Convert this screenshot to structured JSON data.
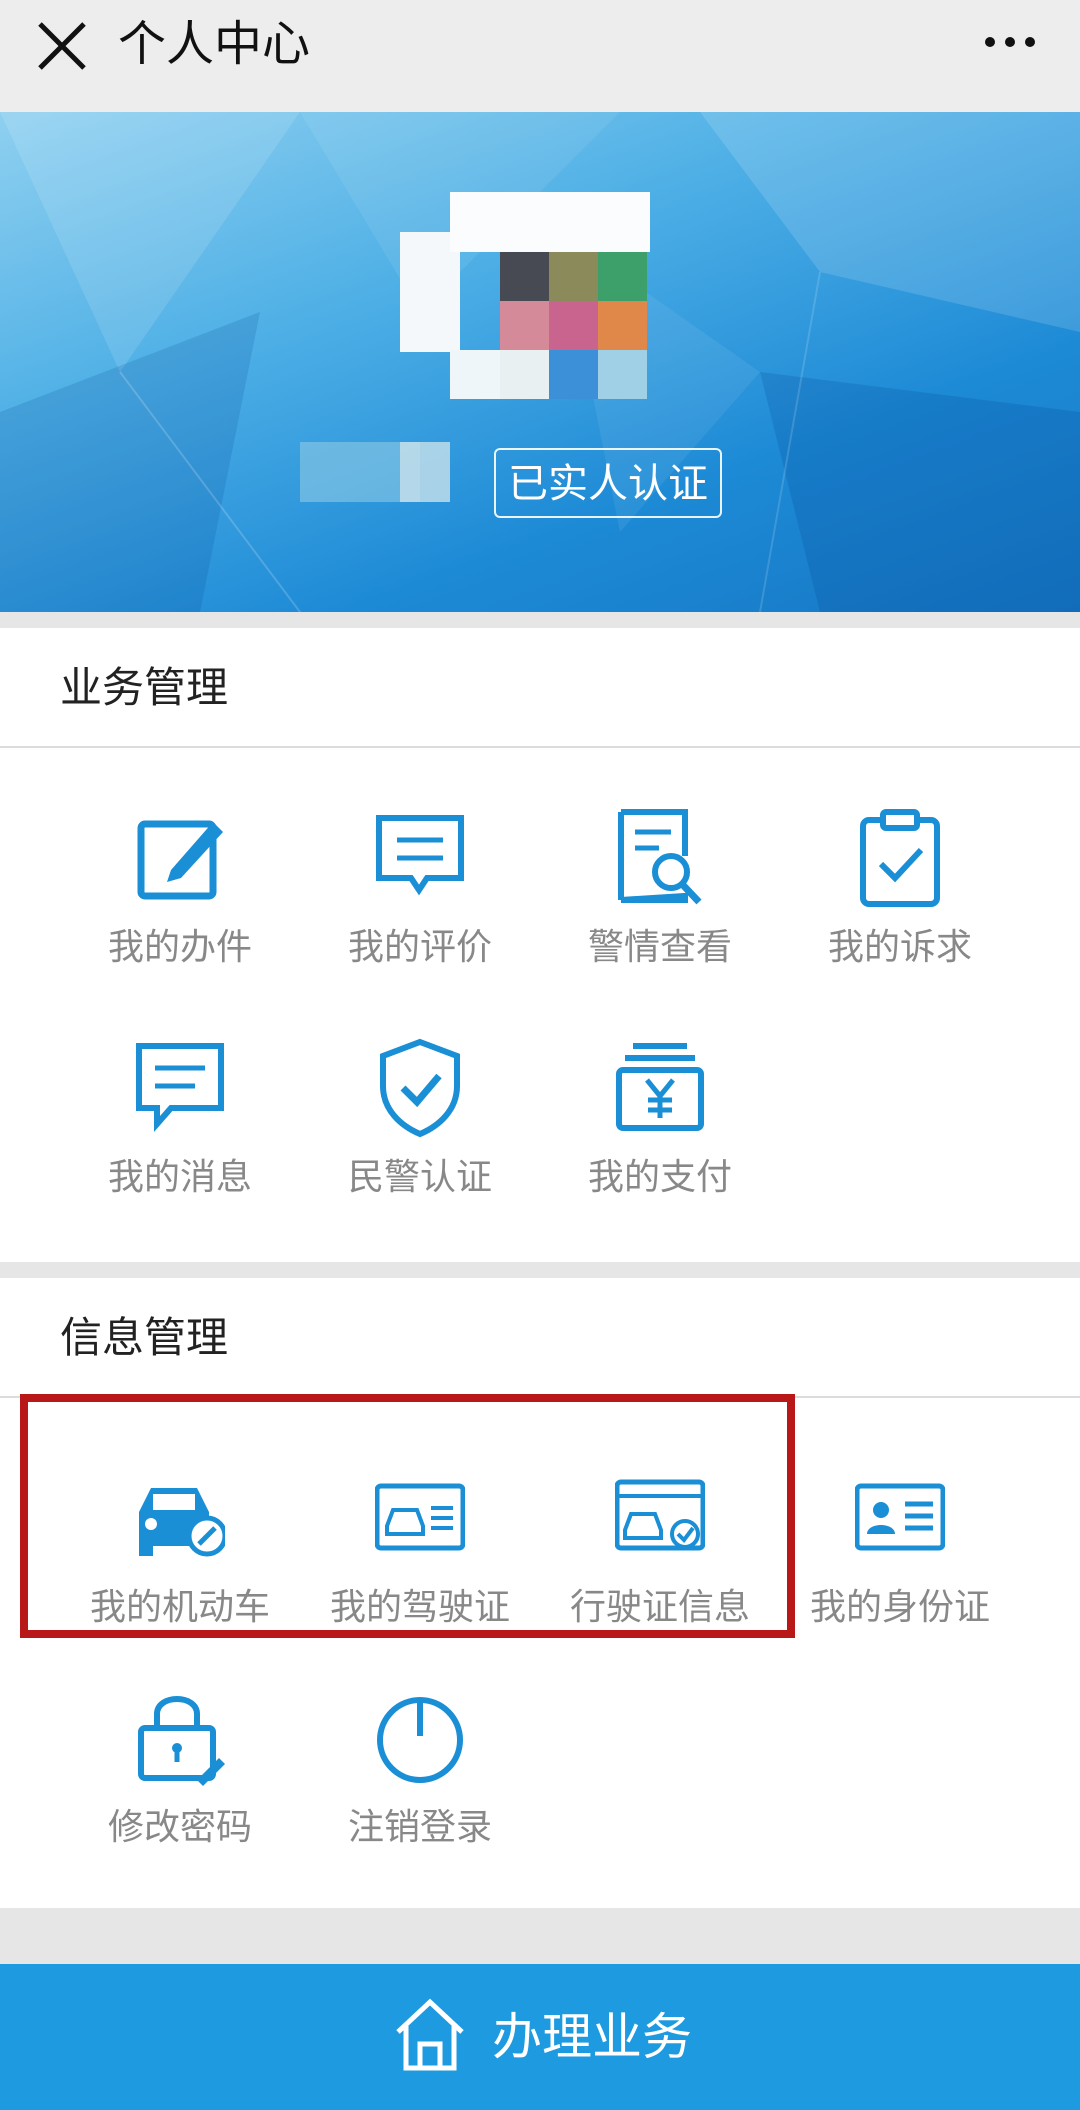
{
  "header": {
    "title": "个人中心"
  },
  "banner": {
    "verify_badge": "已实人认证"
  },
  "sections": {
    "business": {
      "title": "业务管理",
      "items": [
        "我的办件",
        "我的评价",
        "警情查看",
        "我的诉求",
        "我的消息",
        "民警认证",
        "我的支付"
      ]
    },
    "info": {
      "title": "信息管理",
      "items": [
        "我的机动车",
        "我的驾驶证",
        "行驶证信息",
        "我的身份证",
        "修改密码",
        "注销登录"
      ]
    }
  },
  "footer": {
    "label": "办理业务"
  },
  "colors": {
    "accent": "#1d9ae0",
    "icon": "#1a8fd6",
    "highlight": "#b91818"
  }
}
